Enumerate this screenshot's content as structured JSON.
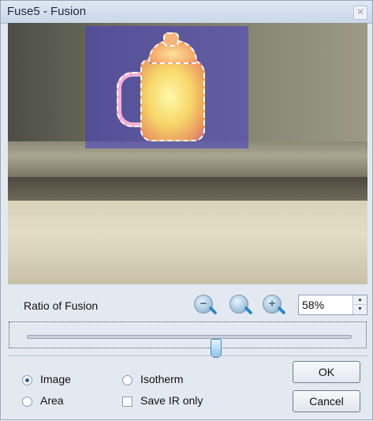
{
  "window": {
    "title": "Fuse5 - Fusion",
    "close_glyph": "✕"
  },
  "controls": {
    "ratio_label": "Ratio of Fusion",
    "zoom_out_icon": "zoom-out-icon",
    "zoom_fit_icon": "zoom-fit-icon",
    "zoom_in_icon": "zoom-in-icon",
    "ratio_value": "58%",
    "slider_percent": 58
  },
  "options": {
    "image_label": "Image",
    "isotherm_label": "Isotherm",
    "area_label": "Area",
    "save_ir_only_label": "Save IR only",
    "selected_mode": "Image",
    "save_ir_only_checked": false
  },
  "buttons": {
    "ok_label": "OK",
    "cancel_label": "Cancel"
  },
  "colors": {
    "ir_overlay": "#463cc8",
    "accent": "#2e87c7"
  }
}
